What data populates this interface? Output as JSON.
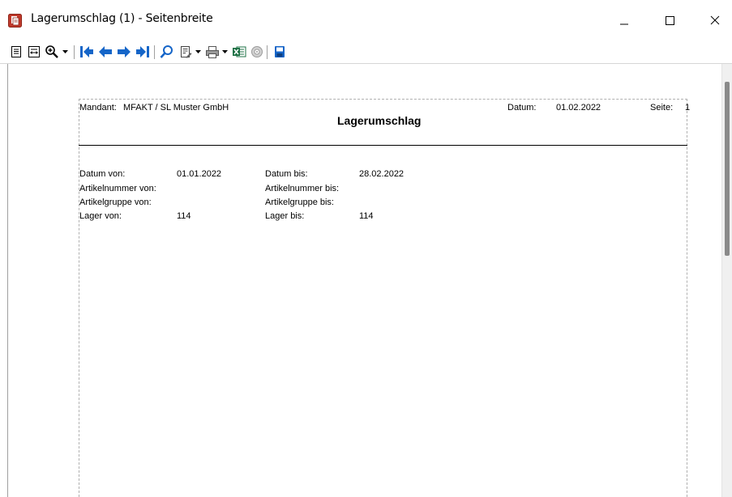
{
  "window": {
    "title": "Lagerumschlag (1) - Seitenbreite"
  },
  "toolbar": {
    "buttons": [
      {
        "name": "single-page-icon"
      },
      {
        "name": "page-width-icon"
      },
      {
        "name": "zoom-icon"
      },
      {
        "name": "first-page-icon"
      },
      {
        "name": "previous-page-icon"
      },
      {
        "name": "next-page-icon"
      },
      {
        "name": "last-page-icon"
      },
      {
        "name": "search-icon"
      },
      {
        "name": "export-icon"
      },
      {
        "name": "print-icon"
      },
      {
        "name": "excel-icon"
      },
      {
        "name": "disc-icon"
      },
      {
        "name": "save-icon"
      }
    ]
  },
  "report": {
    "title": "Lagerumschlag",
    "mandant_label": "Mandant:",
    "mandant_value": "MFAKT  /  SL Muster GmbH",
    "datum_label": "Datum:",
    "datum_value": "01.02.2022",
    "seite_label": "Seite:",
    "seite_value": "1",
    "filters": {
      "datum_von_label": "Datum von:",
      "datum_von_value": "01.01.2022",
      "datum_bis_label": "Datum bis:",
      "datum_bis_value": "28.02.2022",
      "artikelnummer_von_label": "Artikelnummer von:",
      "artikelnummer_bis_label": "Artikelnummer bis:",
      "artikelgruppe_von_label": "Artikelgruppe von:",
      "artikelgruppe_bis_label": "Artikelgruppe bis:",
      "lager_von_label": "Lager von:",
      "lager_von_value": "114",
      "lager_bis_label": "Lager bis:",
      "lager_bis_value": "114"
    }
  },
  "colors": {
    "nav_blue": "#1565c8",
    "app_icon_red": "#c0392b",
    "excel_green": "#1e7145"
  }
}
